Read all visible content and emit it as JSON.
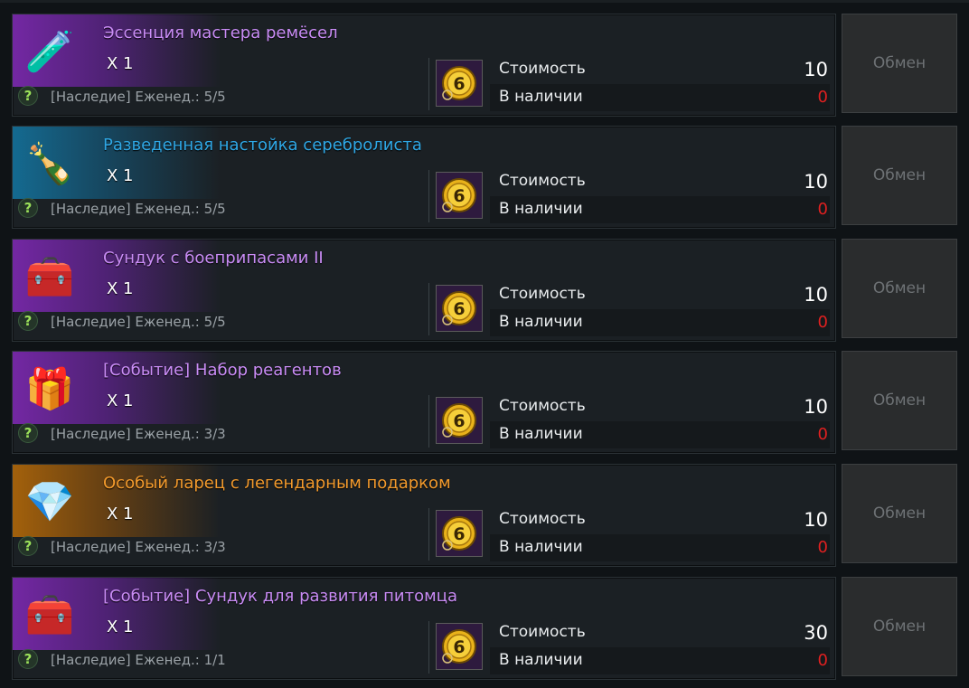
{
  "labels": {
    "cost": "Стоимость",
    "stock": "В наличии",
    "exchange": "Обмен",
    "help": "?"
  },
  "currency": {
    "icon": "event-coin-6-icon",
    "glyph": "6"
  },
  "items": [
    {
      "name": "Эссенция мастера ремёсел",
      "name_color": "#c98cf5",
      "rarity": "purple",
      "icon": "green-potion-icon",
      "icon_glyph": "🧪",
      "quantity": "X 1",
      "limit": "[Наследие] Еженед.: 5/5",
      "cost": "10",
      "stock": "0"
    },
    {
      "name": "Разведенная настойка серебролиста",
      "name_color": "#2fa8e6",
      "rarity": "blue",
      "icon": "herbal-tincture-icon",
      "icon_glyph": "🍾",
      "quantity": "X 1",
      "limit": "[Наследие] Еженед.: 5/5",
      "cost": "10",
      "stock": "0"
    },
    {
      "name": "Сундук с боеприпасами II",
      "name_color": "#c98cf5",
      "rarity": "purple",
      "icon": "ammo-chest-icon",
      "icon_glyph": "🧰",
      "quantity": "X 1",
      "limit": "[Наследие] Еженед.: 5/5",
      "cost": "10",
      "stock": "0"
    },
    {
      "name": "[Событие] Набор реагентов",
      "name_color": "#c98cf5",
      "rarity": "purple",
      "icon": "gift-box-icon",
      "icon_glyph": "🎁",
      "quantity": "X 1",
      "limit": "[Наследие] Еженед.: 3/3",
      "cost": "10",
      "stock": "0"
    },
    {
      "name": "Особый ларец с легендарным подарком",
      "name_color": "#f39a2c",
      "rarity": "orange",
      "icon": "legendary-chest-icon",
      "icon_glyph": "💎",
      "quantity": "X 1",
      "limit": "[Наследие] Еженед.: 3/3",
      "cost": "10",
      "stock": "0"
    },
    {
      "name": "[Событие] Сундук для развития питомца",
      "name_color": "#c98cf5",
      "rarity": "purple",
      "icon": "pet-chest-icon",
      "icon_glyph": "🧰",
      "quantity": "X 1",
      "limit": "[Наследие] Еженед.: 1/1",
      "cost": "30",
      "stock": "0"
    }
  ]
}
